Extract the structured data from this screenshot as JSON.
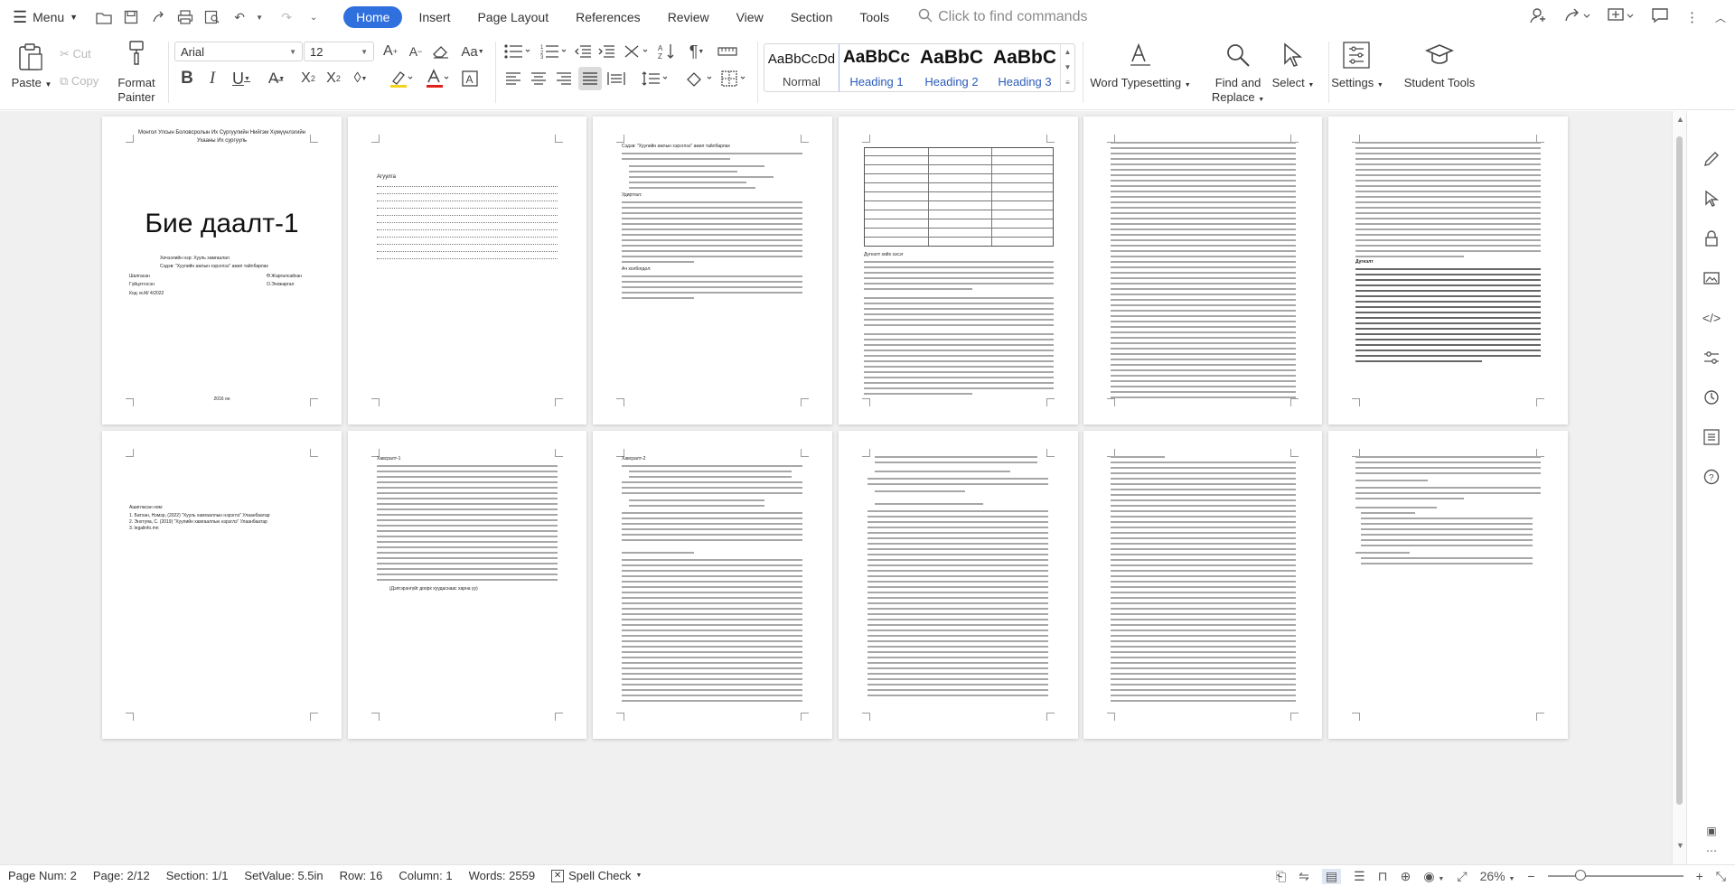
{
  "topbar": {
    "menu_label": "Menu",
    "tabs": [
      {
        "label": "Home",
        "active": true
      },
      {
        "label": "Insert"
      },
      {
        "label": "Page Layout"
      },
      {
        "label": "References"
      },
      {
        "label": "Review"
      },
      {
        "label": "View"
      },
      {
        "label": "Section"
      },
      {
        "label": "Tools"
      }
    ],
    "search_placeholder": "Click to find commands"
  },
  "ribbon": {
    "paste": "Paste",
    "cut": "Cut",
    "copy": "Copy",
    "format_painter": "Format\nPainter",
    "font_name": "Arial",
    "font_size": "12",
    "styles": [
      {
        "preview": "AaBbCcDd",
        "label": "Normal"
      },
      {
        "preview": "AaBbCc",
        "label": "Heading 1"
      },
      {
        "preview": "AaBbC",
        "label": "Heading 2"
      },
      {
        "preview": "AaBbC",
        "label": "Heading 3"
      }
    ],
    "word_typesetting": "Word Typesetting",
    "find_replace": "Find and\nReplace",
    "select": "Select",
    "settings": "Settings",
    "student_tools": "Student Tools"
  },
  "pages": {
    "cover": {
      "header": "Монгол Улсын Боловсролын Их Сургуулийн Нийгэм Хүмүүнлэгийн Ухааны Их сургууль",
      "title": "Бие даалт-1",
      "subject": "Хичээлийн нэр: Хууль хамгаалал",
      "topic": "Сэдэв: \"Хуулийн ажлын хэрэглээ\" ажил тайлбарлах",
      "checked_label": "Шалгасан",
      "checked_name": "Ө.Жаргалсайхан",
      "done_label": "Гүйцэтгэсэн",
      "done_name": "О.Энхжаргал",
      "code": "Код: м.М/ 4/2022",
      "year": "2016 он"
    },
    "toc_heading": "Агуулга",
    "p3_title": "Сэдэв: \"Хуулийн ажлын хэрэглээ\" ажил тайлбарлах",
    "p3_intro": "Удиртгал:",
    "p3_section": "Ач холбогдол:",
    "p4_caption": "Дүгнэлт хийх хэсэг",
    "p6_heading": "Дүгнэлт",
    "p7_heading": "Ашигласан ном:",
    "p7_refs": [
      "1. Батхан, Нэмэр, (2022) \"Хууль хамгааллын нэрэглэ\" Улаанбаатар",
      "2. Энхтуяа, С. (2019) \"Хуулийн хамгааллын нэрэглэ\" Улаанбаатар",
      "3. legalinfo.mn"
    ],
    "p8_heading": "Хавсралт-1",
    "p8_footer": "(Дэлгэрэнгүйг доорх хуудаснаас харна уу)",
    "p9_heading": "Хавсралт-2"
  },
  "status": {
    "page_num": "Page Num: 2",
    "page": "Page: 2/12",
    "section": "Section: 1/1",
    "setvalue": "SetValue: 5.5in",
    "row": "Row: 16",
    "column": "Column: 1",
    "words": "Words: 2559",
    "spell_check": "Spell Check",
    "zoom": "26%"
  }
}
